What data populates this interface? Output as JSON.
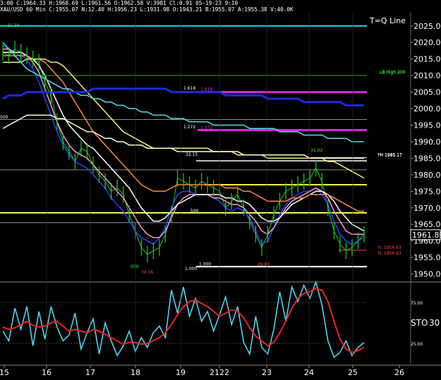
{
  "header": {
    "line1": "3:00  C:1964.33  H:1968.69  L:1961.56  O:1962.58  V:3981  Cl:0.91  05-19-23  9:10",
    "line2": "XAU/USD  60 Min  C:1955.07  N:12.40  H:1956.23  L:1931.98  O:1943.21  B:1955.07  A:1955.38  V:40.0K"
  },
  "tql_label": "T=Q Line",
  "price_current": "1961.89",
  "chart_data": [
    {
      "type": "line",
      "panel": "price",
      "symbol": "XAU/USD",
      "interval": "60 Min",
      "ylim": [
        1948,
        2029
      ],
      "y_ticks": [
        "2025.00",
        "2020.00",
        "2015.00",
        "2010.00",
        "2005.00",
        "2000.00",
        "1995.00",
        "1990.00",
        "1985.00",
        "1980.00",
        "1975.00",
        "1970.00",
        "1965.00",
        "1960.00",
        "1955.00",
        "1950.00"
      ],
      "x_ticks": [
        "15",
        "16",
        "17",
        "18",
        "19",
        "2122",
        "23",
        "24",
        "25",
        "26"
      ],
      "horizontal_levels": [
        {
          "value": 2025,
          "label": "T=Q Line",
          "color": "#00e5e5"
        },
        {
          "value": 2010,
          "label": "LB High 200",
          "color": "#22aa22"
        },
        {
          "value": 2005,
          "label": "1.618",
          "color": "#dd22dd"
        },
        {
          "value": 1993.5,
          "label": "1.272",
          "color": "#dd22dd"
        },
        {
          "value": 1985.17,
          "label": "YH 1985.17",
          "color": "#ffffff"
        },
        {
          "value": 1984.2,
          "label": "",
          "color": "#ffffff"
        },
        {
          "value": 1977,
          "label": "",
          "color": "#ffff44"
        },
        {
          "value": 1968.5,
          "label": "",
          "color": "#ffff44"
        },
        {
          "value": 1957.2,
          "label": "YL 1956.63",
          "color": "#ff4444"
        },
        {
          "value": 1952.2,
          "label": "1.000",
          "color": "#ffffff"
        }
      ],
      "annotations": [
        "21.23",
        "1.618",
        "1.272",
        "32.15",
        "31.02",
        "YH 1985.17",
        "LB High 200",
        "YL 1956.63",
        "70.16",
        "29.87",
        "1.000",
        "000",
        ".500",
        "500"
      ],
      "series": [
        {
          "role": "price",
          "color": "#22cc22",
          "values": [
            2017,
            2016,
            2018,
            2017,
            2016,
            2015,
            2014,
            2008,
            2004,
            1996,
            1990,
            1987,
            1984,
            1988,
            1987,
            1983,
            1980,
            1978,
            1975,
            1976,
            1974,
            1968,
            1963,
            1958,
            1956,
            1957,
            1958,
            1962,
            1968,
            1979,
            1978,
            1977,
            1976,
            1978,
            1977,
            1976,
            1975,
            1970,
            1972,
            1974,
            1970,
            1966,
            1962,
            1958,
            1962,
            1968,
            1972,
            1975,
            1976,
            1977,
            1978,
            1979,
            1982,
            1978,
            1970,
            1963,
            1959,
            1957,
            1958,
            1960,
            1962
          ]
        },
        {
          "role": "ma-blue",
          "color": "#2244ff",
          "values": [
            2019,
            2018,
            2017,
            2016,
            2015,
            2012,
            2008,
            2003,
            1998,
            1993,
            1989,
            1986,
            1984,
            1983,
            1982,
            1980,
            1978,
            1976,
            1973,
            1971,
            1969,
            1966,
            1963,
            1961,
            1960,
            1959,
            1961,
            1964,
            1970,
            1974,
            1975,
            1975,
            1974,
            1974,
            1974,
            1973,
            1972,
            1970,
            1969,
            1970,
            1969,
            1967,
            1963,
            1959,
            1960,
            1964,
            1968,
            1971,
            1973,
            1974,
            1975,
            1975,
            1976,
            1974,
            1971,
            1966,
            1962,
            1960,
            1959,
            1960,
            1961
          ]
        },
        {
          "role": "ma-pink",
          "color": "#ff99cc",
          "values": [
            2018,
            2018,
            2017,
            2017,
            2016,
            2014,
            2011,
            2006,
            2001,
            1996,
            1992,
            1989,
            1987,
            1986,
            1985,
            1983,
            1981,
            1979,
            1977,
            1975,
            1973,
            1970,
            1967,
            1964,
            1962,
            1961,
            1961,
            1963,
            1967,
            1971,
            1973,
            1974,
            1974,
            1974,
            1974,
            1973,
            1973,
            1972,
            1971,
            1971,
            1970,
            1968,
            1966,
            1963,
            1962,
            1964,
            1967,
            1970,
            1972,
            1973,
            1974,
            1975,
            1976,
            1975,
            1973,
            1969,
            1966,
            1963,
            1962,
            1962,
            1962
          ]
        },
        {
          "role": "ma-white",
          "color": "#ffffff",
          "values": [
            2017,
            2017,
            2017,
            2017,
            2016,
            2015,
            2013,
            2010,
            2006,
            2002,
            1998,
            1995,
            1993,
            1991,
            1989,
            1988,
            1986,
            1984,
            1982,
            1980,
            1978,
            1976,
            1973,
            1970,
            1968,
            1966,
            1966,
            1967,
            1969,
            1971,
            1972,
            1973,
            1974,
            1974,
            1974,
            1974,
            1974,
            1973,
            1973,
            1972,
            1972,
            1971,
            1969,
            1967,
            1966,
            1966,
            1967,
            1969,
            1971,
            1972,
            1973,
            1974,
            1975,
            1975,
            1974,
            1972,
            1969,
            1967,
            1965,
            1964,
            1963
          ]
        },
        {
          "role": "ma-orange",
          "color": "#ff8844",
          "values": [
            2016,
            2016,
            2016,
            2016,
            2016,
            2015,
            2015,
            2014,
            2012,
            2010,
            2008,
            2005,
            2002,
            1999,
            1996,
            1993,
            1991,
            1989,
            1987,
            1985,
            1983,
            1981,
            1979,
            1977,
            1976,
            1975,
            1975,
            1975,
            1976,
            1977,
            1977,
            1977,
            1977,
            1977,
            1977,
            1977,
            1977,
            1976,
            1976,
            1976,
            1975,
            1975,
            1974,
            1973,
            1972,
            1972,
            1972,
            1972,
            1973,
            1973,
            1973,
            1974,
            1974,
            1974,
            1974,
            1973,
            1972,
            1971,
            1970,
            1969,
            1969
          ]
        },
        {
          "role": "ma-yellow",
          "color": "#ffee77",
          "values": [
            2014,
            2014,
            2014,
            2014,
            2015,
            2015,
            2015,
            2015,
            2014,
            2014,
            2013,
            2011,
            2009,
            2007,
            2005,
            2003,
            2001,
            1999,
            1997,
            1995,
            1993,
            1992,
            1991,
            1990,
            1989,
            1988,
            1988,
            1988,
            1988,
            1988,
            1988,
            1988,
            1988,
            1988,
            1988,
            1987,
            1987,
            1987,
            1987,
            1986,
            1986,
            1986,
            1986,
            1986,
            1985,
            1985,
            1985,
            1985,
            1985,
            1985,
            1985,
            1985,
            1985,
            1985,
            1984,
            1984,
            1983,
            1982,
            1981,
            1980,
            1979
          ]
        },
        {
          "role": "ma-cyan",
          "color": "#55ddee",
          "values": [
            2020,
            2018,
            2016,
            2014,
            2012,
            2011,
            2010,
            2009,
            2008,
            2007,
            2006,
            2006,
            2005,
            2004,
            2004,
            2003,
            2003,
            2002,
            2002,
            2001,
            2001,
            2000,
            2000,
            1999,
            1999,
            1998,
            1998,
            1998,
            1997,
            1997,
            1997,
            1996,
            1996,
            1996,
            1996,
            1995,
            1995,
            1995,
            1995,
            1995,
            1995,
            1994,
            1994,
            1994,
            1994,
            1994,
            1993,
            1993,
            1993,
            1993,
            1992,
            1992,
            1992,
            1992,
            1991,
            1991,
            1991,
            1991,
            1990,
            1990,
            1990
          ]
        },
        {
          "role": "ma-blue-thick",
          "color": "#1a2bdd",
          "values": [
            2003,
            2004,
            2004,
            2004,
            2005,
            2005,
            2005,
            2005,
            2005,
            2005,
            2005,
            2005,
            2005,
            2005,
            2005,
            2006,
            2006,
            2006,
            2006,
            2006,
            2006,
            2006,
            2006,
            2006,
            2006,
            2006,
            2006,
            2006,
            2005,
            2005,
            2005,
            2005,
            2005,
            2005,
            2005,
            2005,
            2005,
            2004,
            2004,
            2004,
            2004,
            2004,
            2004,
            2004,
            2003,
            2003,
            2003,
            2003,
            2003,
            2003,
            2002,
            2002,
            2002,
            2002,
            2002,
            2002,
            2002,
            2001,
            2001,
            2001,
            2001
          ]
        },
        {
          "role": "ma-cream",
          "color": "#ffffcc",
          "values": [
            1994,
            1995,
            1996,
            1997,
            1998,
            1998,
            1998,
            1998,
            1998,
            1997,
            1997,
            1996,
            1995,
            1994,
            1993,
            1993,
            1992,
            1991,
            1991,
            1990,
            1990,
            1989,
            1989,
            1989,
            1988,
            1988,
            1988,
            1988,
            1988,
            1987,
            1987,
            1987,
            1987,
            1987,
            1987,
            1987,
            1987,
            1987,
            1987,
            1987,
            1986,
            1986,
            1986,
            1986,
            1986,
            1986,
            1986,
            1986,
            1986,
            1986,
            1986,
            1985,
            1985,
            1985,
            1985,
            1985,
            1985,
            1985,
            1985,
            1985,
            1985
          ]
        }
      ]
    },
    {
      "type": "line",
      "panel": "stochastic",
      "label": "STO",
      "period_label": "30",
      "ylim": [
        0,
        100
      ],
      "y_ticks": [
        "75.00",
        "25.00"
      ],
      "series": [
        {
          "role": "k",
          "color": "#55ddff",
          "values": [
            40,
            28,
            68,
            42,
            70,
            22,
            64,
            30,
            70,
            45,
            28,
            35,
            62,
            18,
            38,
            55,
            12,
            50,
            28,
            10,
            22,
            40,
            15,
            32,
            20,
            38,
            46,
            32,
            90,
            62,
            94,
            58,
            80,
            52,
            64,
            40,
            60,
            82,
            48,
            70,
            26,
            12,
            58,
            20,
            12,
            42,
            88,
            52,
            94,
            76,
            96,
            80,
            100,
            72,
            28,
            8,
            14,
            28,
            10,
            20,
            26
          ]
        },
        {
          "role": "d",
          "color": "#ee2222",
          "values": [
            45,
            42,
            44,
            48,
            52,
            47,
            45,
            46,
            50,
            52,
            46,
            40,
            42,
            40,
            38,
            42,
            40,
            36,
            32,
            28,
            24,
            26,
            26,
            24,
            25,
            28,
            32,
            38,
            48,
            60,
            70,
            76,
            78,
            74,
            70,
            64,
            58,
            62,
            66,
            64,
            56,
            44,
            34,
            28,
            22,
            26,
            38,
            52,
            68,
            80,
            86,
            88,
            92,
            90,
            76,
            52,
            30,
            18,
            14,
            16,
            20
          ]
        }
      ]
    }
  ]
}
